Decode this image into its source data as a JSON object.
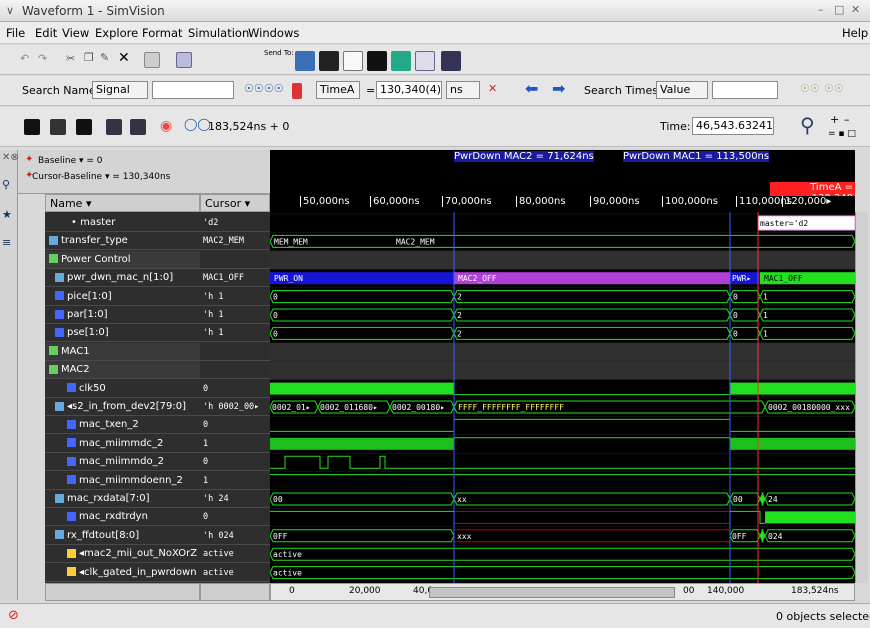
{
  "window": {
    "title": "Waveform 1 - SimVision"
  },
  "menu": [
    "File",
    "Edit",
    "View",
    "Explore",
    "Format",
    "Simulation",
    "Windows",
    "Help"
  ],
  "toolbar1": {
    "send_to": "Send To:"
  },
  "search": {
    "label": "Search Names:",
    "type": "Signal",
    "timeA": "TimeA",
    "eq": "=",
    "value": "130,340(4)",
    "unit": "ns",
    "search_times_label": "Search Times:",
    "search_times_type": "Value"
  },
  "sim": {
    "time_display": "183,524ns + 0",
    "time_label": "Time:",
    "time_value": "46,543.63241ns : 1"
  },
  "header": {
    "baseline": "Baseline ▾ = 0",
    "cursor_baseline": "Cursor-Baseline ▾ = 130,340ns",
    "name_col": "Name ▾",
    "cursor_col": "Cursor ▾"
  },
  "markers": {
    "mac2": "PwrDown MAC2 = 71,624ns",
    "mac2_short": "Pr",
    "mac1": "PwrDown MAC1 = 113,500ns",
    "timeA": "TimeA = 130,340"
  },
  "ticks": [
    "50,000ns",
    "60,000ns",
    "70,000ns",
    "80,000ns",
    "90,000ns",
    "100,000ns",
    "110,000ns",
    "120,000▸"
  ],
  "rows": [
    {
      "name": "• master",
      "cursor": "'d2"
    },
    {
      "name": "transfer_type",
      "cursor": "MAC2_MEM"
    },
    {
      "name": "Power Control",
      "cursor": ""
    },
    {
      "name": "pwr_dwn_mac_n[1:0]",
      "cursor": "MAC1_OFF"
    },
    {
      "name": "pice[1:0]",
      "cursor": "'h 1"
    },
    {
      "name": "par[1:0]",
      "cursor": "'h 1"
    },
    {
      "name": "pse[1:0]",
      "cursor": "'h 1"
    },
    {
      "name": "MAC1",
      "cursor": ""
    },
    {
      "name": "MAC2",
      "cursor": ""
    },
    {
      "name": "clk50",
      "cursor": "0"
    },
    {
      "name": "◂s2_in_from_dev2[79:0]",
      "cursor": "'h 0002_00▸"
    },
    {
      "name": "mac_txen_2",
      "cursor": "0"
    },
    {
      "name": "mac_miimmdc_2",
      "cursor": "1"
    },
    {
      "name": "mac_miimmdo_2",
      "cursor": "0"
    },
    {
      "name": "mac_miimmdoenn_2",
      "cursor": "1"
    },
    {
      "name": "mac_rxdata[7:0]",
      "cursor": "'h 24"
    },
    {
      "name": "mac_rxdtrdyn",
      "cursor": "0"
    },
    {
      "name": "rx_ffdtout[8:0]",
      "cursor": "'h 024"
    },
    {
      "name": "◂mac2_mii_out_NoXOrZ",
      "cursor": "active"
    },
    {
      "name": "◂clk_gated_in_pwrdown",
      "cursor": "active"
    }
  ],
  "wave_text": {
    "master_label": "master='d2",
    "mem_mem": "MEM_MEM",
    "mac2_mem": "MAC2_MEM",
    "pwr_on": "PWR_ON",
    "mac2_off": "MAC2_OFF",
    "pwr_short": "PWR▸",
    "mac1_off": "MAC1_OFF",
    "zero": "0",
    "two": "2",
    "one": "1",
    "s2_a": "0002_01▸",
    "s2_b": "0002_011680▸",
    "s2_c": "0002_00180▸",
    "s2_d": "FFFF_FFFFFFFF_FFFFFFFF",
    "s2_e": "0002_00180000_xxx",
    "rx00": "00",
    "rxxx": "xx",
    "rx24": "24",
    "ff0ff": "0FF",
    "ffxxx": "xxx",
    "ff024": "024",
    "active": "active"
  },
  "hscroll": {
    "t0": "0",
    "t1": "20,000",
    "t2": "40,0",
    "t3": "00",
    "t4": "140,000",
    "end": "183,524ns"
  },
  "status": {
    "objects": "0 objects selected"
  },
  "colors": {
    "green": "#22e020",
    "blue": "#1515d8",
    "purple": "#b040d8",
    "red": "#c00000",
    "cursor_red": "#ff3030"
  }
}
